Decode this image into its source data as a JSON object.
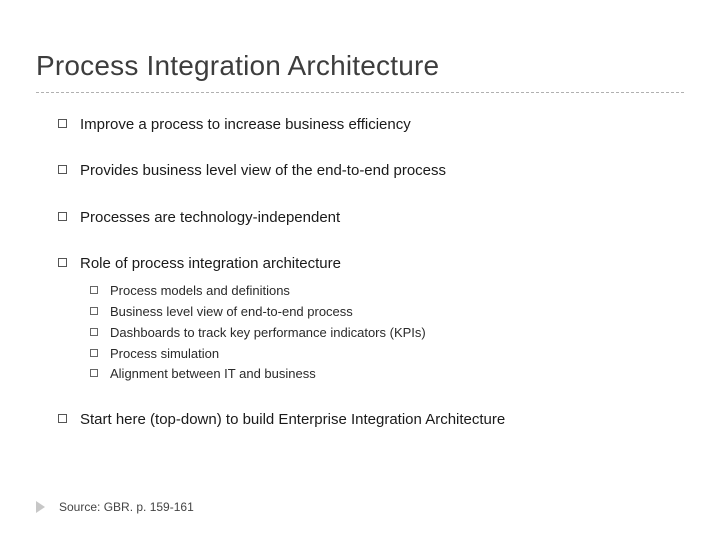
{
  "title": "Process Integration Architecture",
  "bullets": {
    "b0": "Improve a process to increase business efficiency",
    "b1": "Provides business level view of the end-to-end process",
    "b2": "Processes are technology-independent",
    "b3": "Role of process integration architecture",
    "b4": "Start here (top-down) to build Enterprise Integration Architecture"
  },
  "sub": {
    "s0": "Process models and definitions",
    "s1": "Business level view of end-to-end process",
    "s2": "Dashboards to track key performance indicators (KPIs)",
    "s3": "Process simulation",
    "s4": "Alignment between IT and business"
  },
  "source": "Source: GBR. p. 159-161"
}
